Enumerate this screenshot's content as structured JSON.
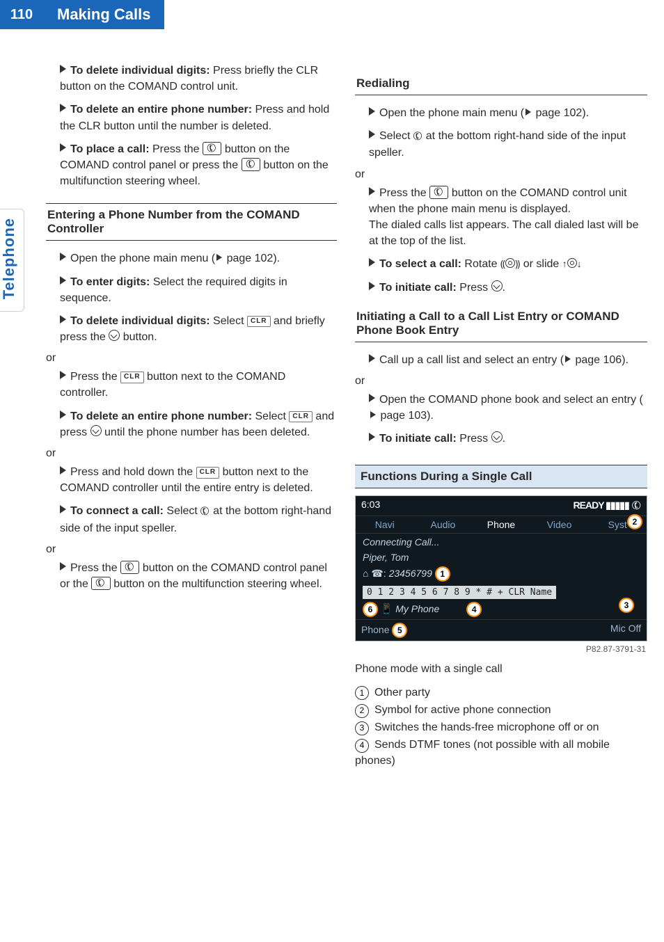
{
  "page_number": "110",
  "chapter_title": "Making Calls",
  "side_tab": "Telephone",
  "left": {
    "b1": {
      "bold": "To delete individual digits:",
      "rest": " Press briefly the CLR button on the COMAND control unit."
    },
    "b2": {
      "bold": "To delete an entire phone number:",
      "rest": " Press and hold the CLR button until the number is deleted."
    },
    "b3": {
      "bold": "To place a call:",
      "rest1": " Press the ",
      "rest2": " button on the COMAND control panel or press the ",
      "rest3": " button on the multifunction steering wheel."
    },
    "h1": "Entering a Phone Number from the COMAND Controller",
    "b4": {
      "text1": "Open the phone main menu (",
      "tri": "▷",
      "text2": " page 102)."
    },
    "b5": {
      "bold": "To enter digits:",
      "rest": " Select the required digits in sequence."
    },
    "b6": {
      "bold": "To delete individual digits:",
      "rest1": " Select ",
      "clr": "CLR",
      "rest2": " and briefly press the ",
      "rest3": " button."
    },
    "or1": "or",
    "b7": {
      "text1": "Press the ",
      "clr": "CLR",
      "text2": " button next to the COMAND controller."
    },
    "b8": {
      "bold": "To delete an entire phone number:",
      "rest1": " Select ",
      "clr": "CLR",
      "rest2": " and press ",
      "rest3": " until the phone number has been deleted."
    },
    "or2": "or",
    "b9": {
      "text1": "Press and hold down the ",
      "clr": "CLR",
      "text2": " button next to the COMAND controller until the entire entry is deleted."
    },
    "b10": {
      "bold": "To connect a call:",
      "rest1": " Select ",
      "rest2": " at the bottom right-hand side of the input speller."
    },
    "or3": "or",
    "b11": {
      "text1": "Press the ",
      "text2": " button on the COMAND control panel or the ",
      "text3": " button on the multifunction steering wheel."
    }
  },
  "right": {
    "h1": "Redialing",
    "b1": {
      "text1": "Open the phone main menu (",
      "tri": "▷",
      "text2": " page 102)."
    },
    "b2": {
      "text1": "Select ",
      "text2": " at the bottom right-hand side of the input speller."
    },
    "or1": "or",
    "b3": {
      "text1": "Press the ",
      "text2": " button on the COMAND control unit when the phone main menu is displayed.",
      "text3": "The dialed calls list appears. The call dialed last will be at the top of the list."
    },
    "b4": {
      "bold": "To select a call:",
      "rest1": " Rotate ",
      "rest2": " or slide "
    },
    "b5": {
      "bold": "To initiate call:",
      "rest": " Press "
    },
    "h2": "Initiating a Call to a Call List Entry or COMAND Phone Book Entry",
    "b6": {
      "text1": "Call up a call list and select an entry (",
      "tri": "▷",
      "text2": " page 106)."
    },
    "or2": "or",
    "b7": {
      "text1": "Open the COMAND phone book and select an entry (",
      "tri": "▷",
      "text2": " page 103)."
    },
    "b8": {
      "bold": "To initiate call:",
      "rest": " Press "
    },
    "h3": "Functions During a Single Call",
    "screenshot": {
      "time": "6:03",
      "ready": "READY ▮▮▮▮▮",
      "tabs": [
        "Navi",
        "Audio",
        "Phone",
        "Video",
        "Syst"
      ],
      "connecting": "Connecting Call...",
      "name": "Piper, Tom",
      "numline_prefix": "⌂ ☎: ",
      "numline": "23456799",
      "digits": "0 1 2 3 4 5 6 7 8 9 * # + CLR Name",
      "myphone": "My Phone",
      "phone_label": "Phone",
      "micoff": "Mic Off",
      "callouts": {
        "c1": "1",
        "c2": "2",
        "c3": "3",
        "c4": "4",
        "c5": "5",
        "c6": "6"
      }
    },
    "figid": "P82.87-3791-31",
    "caption": "Phone mode with a single call",
    "legend": {
      "l1": "Other party",
      "l2": "Symbol for active phone connection",
      "l3": "Switches the hands-free microphone off or on",
      "l4": "Sends DTMF tones (not possible with all mobile phones)"
    }
  },
  "icons": {
    "handset_box": "✆",
    "handset": "✆",
    "clr": "CLR"
  }
}
